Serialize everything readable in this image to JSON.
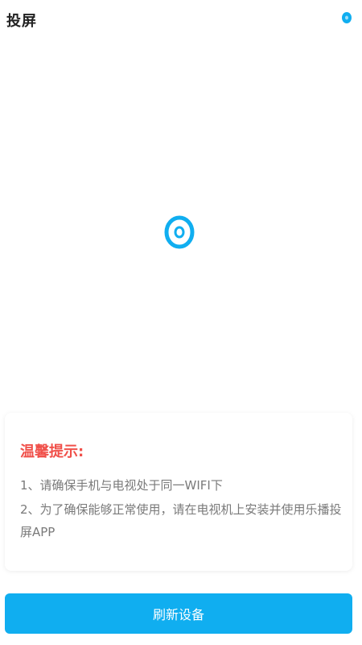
{
  "header": {
    "title": "投屏",
    "top_icon": "device-indicator-icon"
  },
  "center": {
    "icon": "cast-target-icon"
  },
  "tips": {
    "title": "温馨提示:",
    "line1": "1、请确保手机与电视处于同一WIFI下",
    "line2": "2、为了确保能够正常使用，请在电视机上安装并使用乐播投屏APP"
  },
  "actions": {
    "refresh_label": "刷新设备"
  },
  "colors": {
    "accent": "#10aef0",
    "warning": "#f0504a",
    "text_primary": "#222222",
    "text_secondary": "#7a7a7a"
  }
}
